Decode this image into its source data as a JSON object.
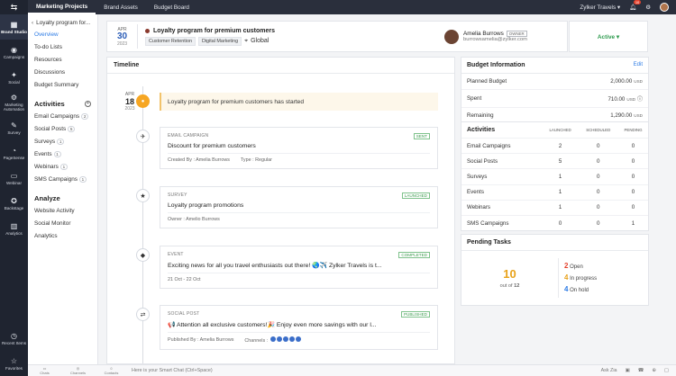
{
  "rail": {
    "menu_icon": "⇆",
    "items": [
      {
        "label": "Brand Studio",
        "icon": "▦"
      },
      {
        "label": "Campaigns",
        "icon": "◉"
      },
      {
        "label": "Social",
        "icon": "✦"
      },
      {
        "label": "Marketing Automation",
        "icon": "⚙"
      },
      {
        "label": "Survey",
        "icon": "✎"
      },
      {
        "label": "PageSense",
        "icon": "◔"
      },
      {
        "label": "Webinar",
        "icon": "▭"
      },
      {
        "label": "Backstage",
        "icon": "✪"
      },
      {
        "label": "Analytics",
        "icon": "▥"
      }
    ],
    "bottom": [
      {
        "label": "Recent Items",
        "icon": "◷"
      },
      {
        "label": "Favorites",
        "icon": "☆"
      }
    ]
  },
  "topbar": {
    "tabs": [
      "Marketing Projects",
      "Brand Assets",
      "Budget Board"
    ],
    "org": "Zylker Travels ▾",
    "notif_count": "10"
  },
  "subside": {
    "back_label": "Loyalty program for...",
    "links": [
      "Overview",
      "To-do Lists",
      "Resources",
      "Discussions",
      "Budget Summary"
    ],
    "activities_title": "Activities",
    "activities": [
      {
        "label": "Email Campaigns",
        "count": "2"
      },
      {
        "label": "Social Posts",
        "count": "5"
      },
      {
        "label": "Surveys",
        "count": "1"
      },
      {
        "label": "Events",
        "count": "1"
      },
      {
        "label": "Webinars",
        "count": "1"
      },
      {
        "label": "SMS Campaigns",
        "count": "1"
      }
    ],
    "analyze_title": "Analyze",
    "analyze": [
      "Website Activity",
      "Social Monitor",
      "Analytics"
    ]
  },
  "header": {
    "month": "APR",
    "day": "30",
    "year": "2023",
    "title": "Loyalty program for premium customers",
    "tags": [
      "Customer Retention",
      "Digital Marketing"
    ],
    "location": "Global",
    "owner_name": "Amelia Burrows",
    "owner_badge": "OWNER",
    "owner_email": "burrowsamelia@zylker.com",
    "status": "Active ▾"
  },
  "timeline": {
    "title": "Timeline",
    "month": "APR",
    "day": "18",
    "year": "2023",
    "start_text": "Loyalty program for premium customers has started",
    "cards": [
      {
        "type": "EMAIL CAMPAIGN",
        "status": "SENT",
        "title": "Discount for premium customers",
        "meta1": "Created By : Amelia Burrows",
        "meta2": "Type : Regular",
        "icon": "✈"
      },
      {
        "type": "SURVEY",
        "status": "LAUNCHED",
        "title": "Loyalty program promotions",
        "meta1": "Owner : Amelio Burrows",
        "meta2": "",
        "icon": "★"
      },
      {
        "type": "EVENT",
        "status": "COMPLETED",
        "title": "Exciting news for all you travel enthusiasts out there! 🌏✈️ Zylker Travels is t...",
        "meta1": "21 Oct - 22 Oct",
        "meta2": "",
        "icon": "◆"
      },
      {
        "type": "SOCIAL POST",
        "status": "PUBLISHED",
        "title": "📢 Attention all exclusive customers!🎉 Enjoy even more savings with our l...",
        "meta1": "Published By : Amelia Burrows",
        "meta2": "Channels :",
        "icon": "⇄"
      }
    ]
  },
  "budget": {
    "title": "Budget Information",
    "edit": "Edit",
    "rows": [
      {
        "label": "Planned Budget",
        "value": "2,000.00",
        "cur": "USD"
      },
      {
        "label": "Spent",
        "value": "710.00",
        "cur": "USD"
      },
      {
        "label": "Remaining",
        "value": "1,290.00",
        "cur": "USD"
      }
    ]
  },
  "activities": {
    "title": "Activities",
    "cols": [
      "LAUNCHED",
      "SCHEDULED",
      "PENDING"
    ],
    "rows": [
      {
        "label": "Email Campaigns",
        "v": [
          "2",
          "0",
          "0"
        ]
      },
      {
        "label": "Social Posts",
        "v": [
          "5",
          "0",
          "0"
        ]
      },
      {
        "label": "Surveys",
        "v": [
          "1",
          "0",
          "0"
        ]
      },
      {
        "label": "Events",
        "v": [
          "1",
          "0",
          "0"
        ]
      },
      {
        "label": "Webinars",
        "v": [
          "1",
          "0",
          "0"
        ]
      },
      {
        "label": "SMS Campaigns",
        "v": [
          "0",
          "0",
          "1"
        ]
      }
    ]
  },
  "pending": {
    "title": "Pending Tasks",
    "total": "10",
    "out_of_label": "out of",
    "out_of": "12",
    "open": "2",
    "open_label": "Open",
    "progress": "4",
    "progress_label": "In progress",
    "hold": "4",
    "hold_label": "On hold",
    "colors": {
      "open": "#e4412c",
      "progress": "#e8a21a",
      "hold": "#2c7be5"
    }
  },
  "bottombar": {
    "items": [
      "Chats",
      "Channels",
      "Contacts"
    ],
    "chat_placeholder": "Here is your Smart Chat (Ctrl+Space)",
    "right": [
      "Ask Zia",
      "▣",
      "☎",
      "⊕",
      "▢"
    ]
  }
}
